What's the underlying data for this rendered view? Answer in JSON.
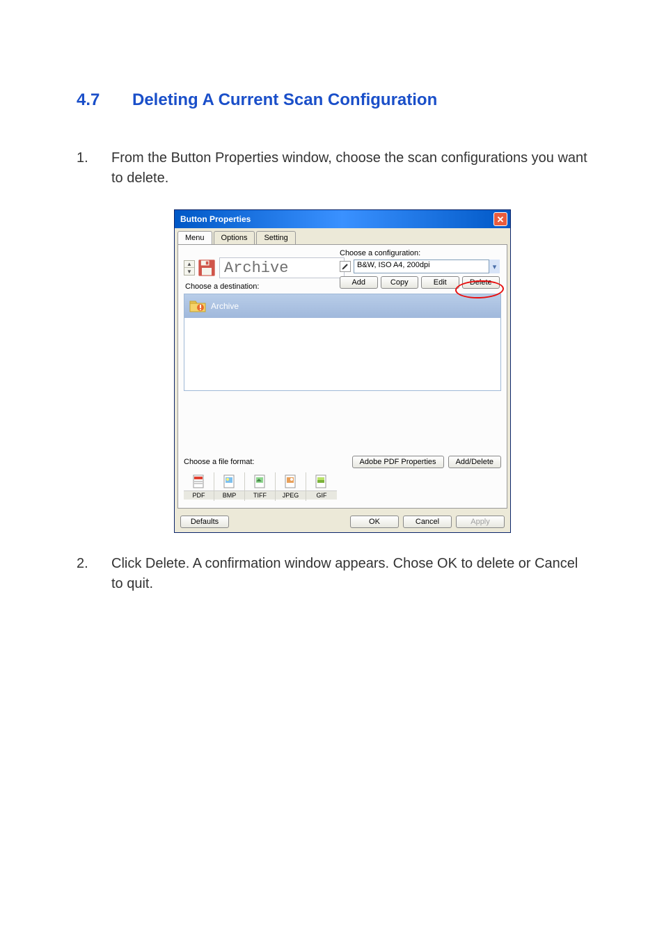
{
  "heading": {
    "num": "4.7",
    "title": "Deleting A Current Scan Configuration"
  },
  "step1": {
    "num": "1.",
    "text": "From the Button Properties window, choose the scan configurations you want to delete."
  },
  "step2": {
    "num": "2.",
    "text": "Click Delete. A confirmation window appears. Chose OK to delete or Cancel to quit."
  },
  "window": {
    "title": "Button Properties",
    "tabs": {
      "menu": "Menu",
      "options": "Options",
      "setting": "Setting"
    },
    "config_label": "Choose a configuration:",
    "config_value": "B&W, ISO A4, 200dpi",
    "btn_add": "Add",
    "btn_copy": "Copy",
    "btn_edit": "Edit",
    "btn_delete": "Delete",
    "profile_name": "Archive",
    "choose_dest_label": "Choose a destination:",
    "dest_item": "Archive",
    "choose_format_label": "Choose a file format:",
    "btn_adobe": "Adobe PDF Properties",
    "btn_adddelete": "Add/Delete",
    "formats": {
      "pdf": "PDF",
      "bmp": "BMP",
      "tiff": "TIFF",
      "jpeg": "JPEG",
      "gif": "GIF"
    },
    "btn_defaults": "Defaults",
    "btn_ok": "OK",
    "btn_cancel": "Cancel",
    "btn_apply": "Apply"
  }
}
